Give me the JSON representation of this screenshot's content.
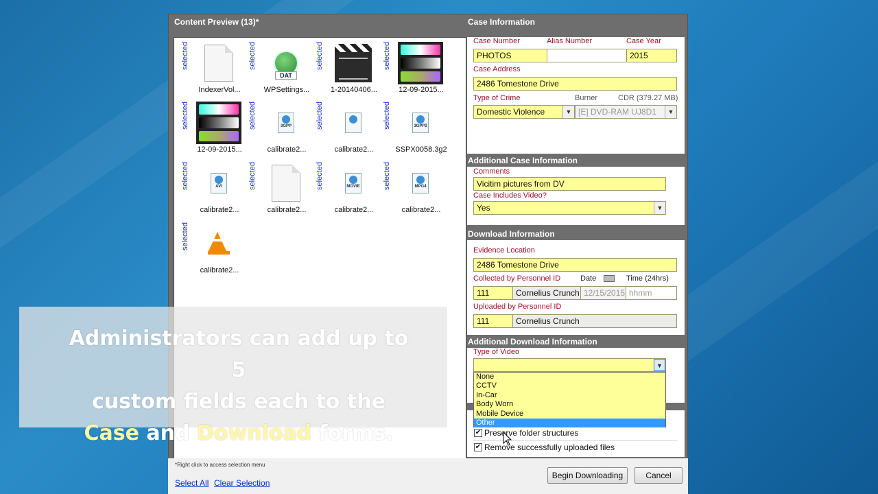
{
  "dialog": {
    "preview_title": "Content Preview (13)*",
    "case_title": "Case Information"
  },
  "preview": {
    "selected_label": "selected",
    "files": [
      {
        "name": "IndexerVol...",
        "icon": "document-icon"
      },
      {
        "name": "WPSettings...",
        "icon": "dat-file-icon",
        "badge": "DAT"
      },
      {
        "name": "1-20140406...",
        "icon": "video-clapper-icon"
      },
      {
        "name": "12-09-2015...",
        "icon": "color-bars-thumbnail"
      },
      {
        "name": "12-09-2015...",
        "icon": "color-bars-thumbnail"
      },
      {
        "name": "calibrate2...",
        "icon": "3gpp-file-icon",
        "badge": "3GPP"
      },
      {
        "name": "calibrate2...",
        "icon": "media-file-icon",
        "badge": ""
      },
      {
        "name": "SSPX0058.3g2",
        "icon": "3gpp2-file-icon",
        "badge": "3GPP2"
      },
      {
        "name": "calibrate2...",
        "icon": "avi-file-icon",
        "badge": "AVI"
      },
      {
        "name": "calibrate2...",
        "icon": "document-icon"
      },
      {
        "name": "calibrate2...",
        "icon": "movie-file-icon",
        "badge": "MOVIE"
      },
      {
        "name": "calibrate2...",
        "icon": "mpeg4-file-icon",
        "badge": "MPG4"
      },
      {
        "name": "calibrate2...",
        "icon": "vlc-cone-icon"
      }
    ]
  },
  "overlay": {
    "line1": "Administrators can add up to 5",
    "line2": "custom fields each to the",
    "line3_a": "Case",
    "line3_b": " and ",
    "line3_c": "Download",
    "line3_d": " forms."
  },
  "case_info": {
    "case_number_label": "Case Number",
    "case_number": "PHOTOS",
    "alias_label": "Alias Number",
    "alias": "",
    "year_label": "Case Year",
    "year": "2015",
    "address_label": "Case Address",
    "address": "2486 Tomestone Drive",
    "crime_label": "Type of Crime",
    "crime": "Domestic Violence",
    "burner_label": "Burner",
    "burner_capacity": "CDR (379.27 MB)",
    "burner": "[E] DVD-RAM UJ8D1"
  },
  "additional_case": {
    "header": "Additional Case Information",
    "comments_label": "Comments",
    "comments": "Vicitim pictures from DV",
    "video_label": "Case Includes Video?",
    "video": "Yes"
  },
  "download_info": {
    "header": "Download Information",
    "evidence_label": "Evidence Location",
    "evidence": "2486 Tomestone Drive",
    "collected_label": "Collected by Personnel ID",
    "collected_id": "111",
    "collected_name": "Cornelius Crunch",
    "date_label": "Date",
    "date": "12/15/2015",
    "time_label": "Time (24hrs)",
    "time_placeholder": "hhmm",
    "uploaded_label": "Uploaded by Personnel ID",
    "uploaded_id": "111",
    "uploaded_name": "Cornelius Crunch"
  },
  "additional_download": {
    "header": "Additional Download Information",
    "video_type_label": "Type of Video",
    "video_type": "",
    "options": [
      "None",
      "CCTV",
      "In-Car",
      "Body Worn",
      "Mobile Device",
      "Other"
    ],
    "highlighted_option": "Other"
  },
  "options": {
    "preserve_label": "Preserve folder structures",
    "preserve_checked": true,
    "remove_label": "Remove successfully uploaded files",
    "remove_checked": true
  },
  "bottom": {
    "hint": "*Right click to access selection menu",
    "select_all": "Select All",
    "clear_selection": "Clear Selection",
    "begin": "Begin Downloading",
    "cancel": "Cancel"
  },
  "colors": {
    "required_label": "#a0102c",
    "field_fill": "#ffff99",
    "selected_text": "#1a2fd0",
    "list_highlight": "#3399ff",
    "link": "#0033cc"
  }
}
